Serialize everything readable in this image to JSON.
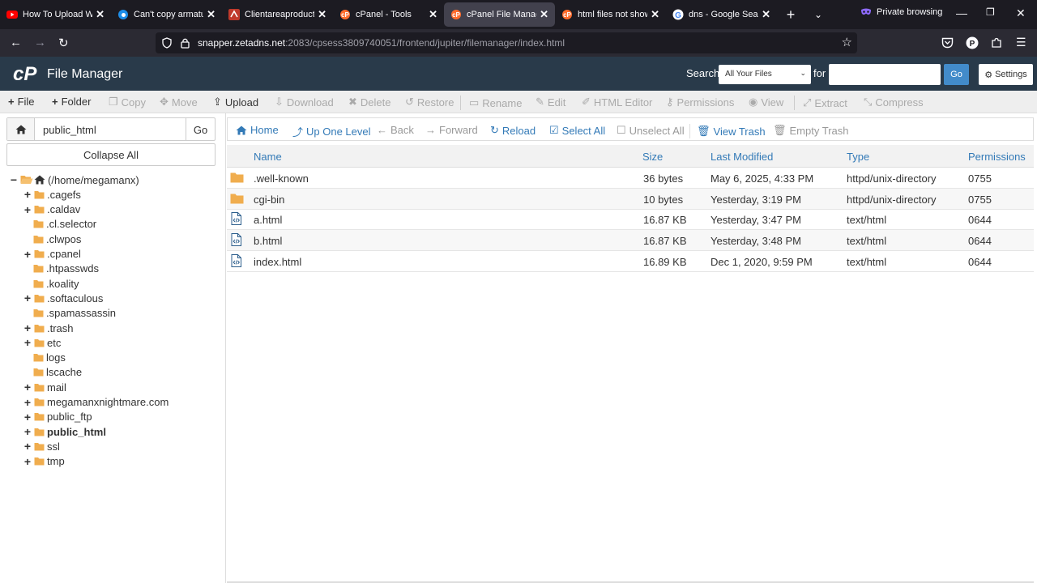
{
  "browser": {
    "tabs": [
      {
        "label": "How To Upload Web",
        "icon": "youtube-icon",
        "active": false
      },
      {
        "label": "Can't copy armature",
        "icon": "blender-icon",
        "active": false
      },
      {
        "label": "Clientareaproductde",
        "icon": "hosting-icon",
        "active": false
      },
      {
        "label": "cPanel - Tools",
        "icon": "cpanel-icon",
        "active": false
      },
      {
        "label": "cPanel File Manager",
        "icon": "cpanel-icon",
        "active": true
      },
      {
        "label": "html files not showin",
        "icon": "cpanel-icon",
        "active": false
      },
      {
        "label": "dns - Google Search",
        "icon": "google-icon",
        "active": false
      }
    ],
    "private_label": "Private browsing",
    "url_host": "snapper.zetadns.net",
    "url_prefix": "",
    "url_suffix": ":2083/cpsess3809740051/frontend/jupiter/filemanager/index.html"
  },
  "header": {
    "logo": "cP",
    "title": "File Manager",
    "search_label": "Search",
    "search_scope": "All Your Files",
    "for_label": "for",
    "search_value": "",
    "go_label": "Go",
    "settings_label": "Settings"
  },
  "toolbar": {
    "file": "File",
    "folder": "Folder",
    "copy": "Copy",
    "move": "Move",
    "upload": "Upload",
    "download": "Download",
    "delete": "Delete",
    "restore": "Restore",
    "rename": "Rename",
    "edit": "Edit",
    "html_editor": "HTML Editor",
    "permissions": "Permissions",
    "view": "View",
    "extract": "Extract",
    "compress": "Compress"
  },
  "left": {
    "path_value": "public_html",
    "go_label": "Go",
    "collapse_label": "Collapse All",
    "root_label": "(/home/megamanx)",
    "tree": [
      {
        "label": ".cagefs",
        "expandable": true,
        "bold": false
      },
      {
        "label": ".caldav",
        "expandable": true,
        "bold": false
      },
      {
        "label": ".cl.selector",
        "expandable": false,
        "bold": false
      },
      {
        "label": ".clwpos",
        "expandable": false,
        "bold": false
      },
      {
        "label": ".cpanel",
        "expandable": true,
        "bold": false
      },
      {
        "label": ".htpasswds",
        "expandable": false,
        "bold": false
      },
      {
        "label": ".koality",
        "expandable": false,
        "bold": false
      },
      {
        "label": ".softaculous",
        "expandable": true,
        "bold": false
      },
      {
        "label": ".spamassassin",
        "expandable": false,
        "bold": false
      },
      {
        "label": ".trash",
        "expandable": true,
        "bold": false
      },
      {
        "label": "etc",
        "expandable": true,
        "bold": false
      },
      {
        "label": "logs",
        "expandable": false,
        "bold": false
      },
      {
        "label": "lscache",
        "expandable": false,
        "bold": false
      },
      {
        "label": "mail",
        "expandable": true,
        "bold": false
      },
      {
        "label": "megamanxnightmare.com",
        "expandable": true,
        "bold": false
      },
      {
        "label": "public_ftp",
        "expandable": true,
        "bold": false
      },
      {
        "label": "public_html",
        "expandable": true,
        "bold": true
      },
      {
        "label": "ssl",
        "expandable": true,
        "bold": false
      },
      {
        "label": "tmp",
        "expandable": true,
        "bold": false
      }
    ]
  },
  "right_toolbar": {
    "home": "Home",
    "up": "Up One Level",
    "back": "Back",
    "forward": "Forward",
    "reload": "Reload",
    "select_all": "Select All",
    "unselect_all": "Unselect All",
    "view_trash": "View Trash",
    "empty_trash": "Empty Trash"
  },
  "files": {
    "columns": {
      "name": "Name",
      "size": "Size",
      "modified": "Last Modified",
      "type": "Type",
      "perms": "Permissions"
    },
    "rows": [
      {
        "icon": "folder-icon",
        "name": ".well-known",
        "size": "36 bytes",
        "modified": "May 6, 2025, 4:33 PM",
        "type": "httpd/unix-directory",
        "perms": "0755"
      },
      {
        "icon": "folder-icon",
        "name": "cgi-bin",
        "size": "10 bytes",
        "modified": "Yesterday, 3:19 PM",
        "type": "httpd/unix-directory",
        "perms": "0755"
      },
      {
        "icon": "html-file-icon",
        "name": "a.html",
        "size": "16.87 KB",
        "modified": "Yesterday, 3:47 PM",
        "type": "text/html",
        "perms": "0644"
      },
      {
        "icon": "html-file-icon",
        "name": "b.html",
        "size": "16.87 KB",
        "modified": "Yesterday, 3:48 PM",
        "type": "text/html",
        "perms": "0644"
      },
      {
        "icon": "html-file-icon",
        "name": "index.html",
        "size": "16.89 KB",
        "modified": "Dec 1, 2020, 9:59 PM",
        "type": "text/html",
        "perms": "0644"
      }
    ]
  },
  "colors": {
    "header_bg": "#293a4a",
    "link": "#337ab7",
    "folder": "#f0ad4e",
    "go_button": "#428bca"
  }
}
